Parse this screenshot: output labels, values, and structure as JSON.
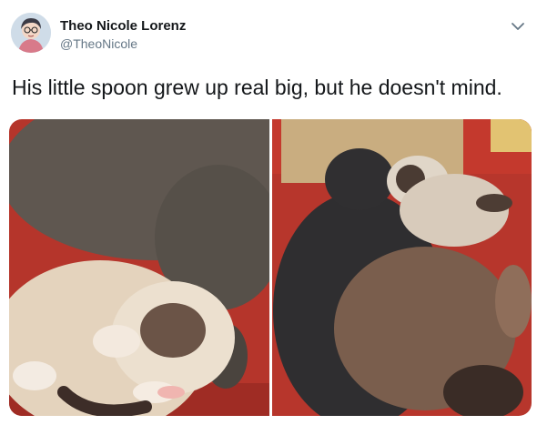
{
  "tweet": {
    "author_name": "Theo Nicole Lorenz",
    "author_handle": "@TheoNicole",
    "text": "His little spoon grew up real big, but he doesn't mind."
  },
  "media": {
    "photos": [
      {
        "subject": "grumpy-cat-curled-against-gray-cat"
      },
      {
        "subject": "gray-cat-hugging-siamese-cat"
      }
    ]
  },
  "icons": {
    "avatar": "avatar-illustration",
    "menu": "chevron-down-icon"
  },
  "colors": {
    "name_text": "#14171a",
    "handle_text": "#657786",
    "couch_red": "#b8362c"
  }
}
